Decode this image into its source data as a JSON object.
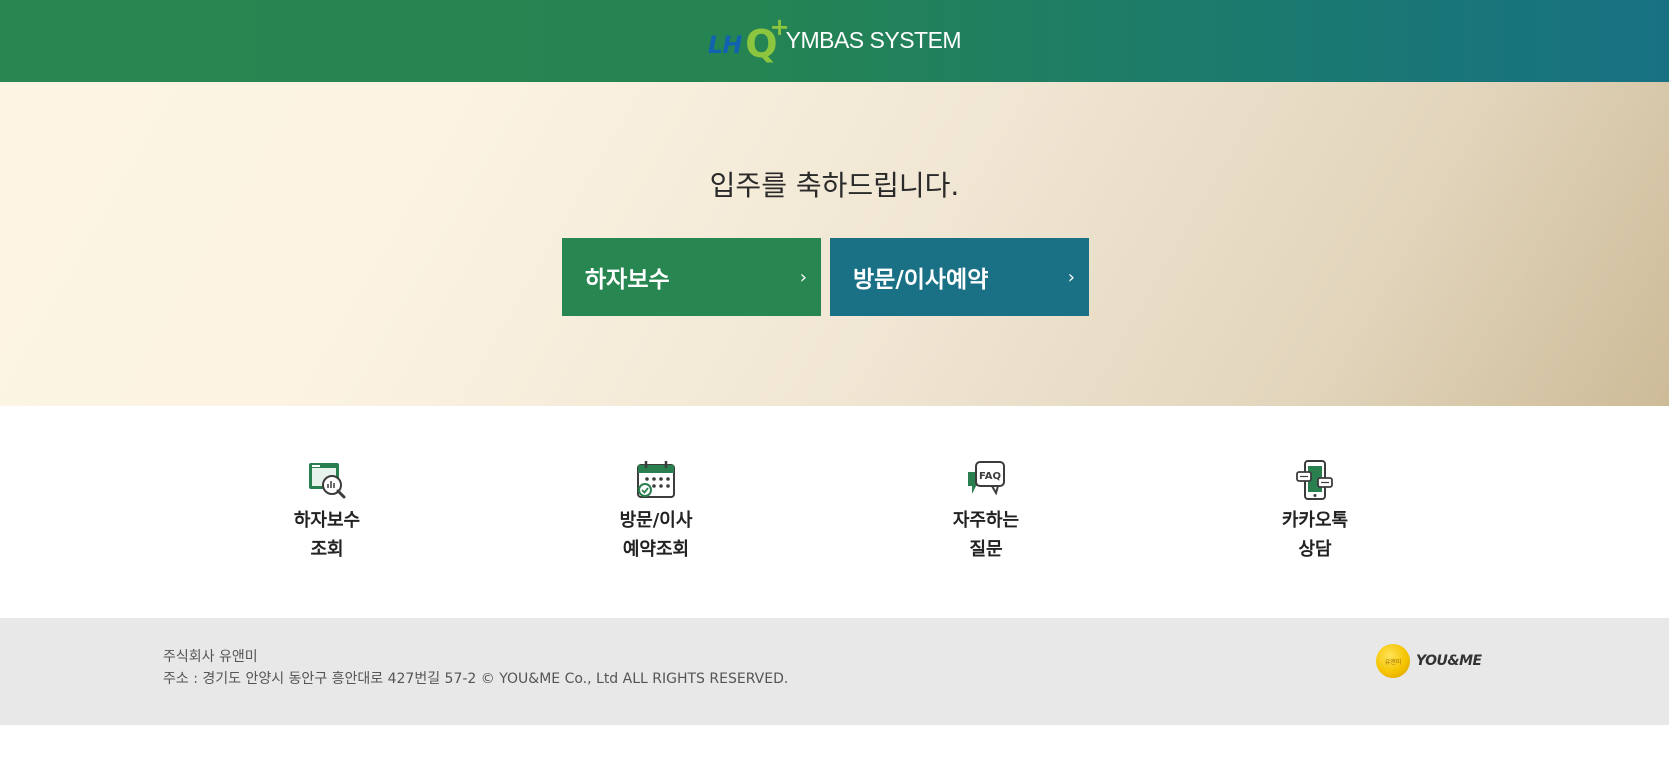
{
  "header": {
    "logo_lh": "LH",
    "logo_q": "Q",
    "logo_plus": "+",
    "logo_system": "YMBAS SYSTEM"
  },
  "hero": {
    "title": "입주를 축하드립니다.",
    "buttons": [
      {
        "label": "하자보수",
        "chevron": "›",
        "color": "#288650"
      },
      {
        "label": "방문/이사예약",
        "chevron": "›",
        "color": "#1a7185"
      }
    ]
  },
  "quick_links": [
    {
      "line1": "하자보수",
      "line2": "조회",
      "icon": "defect-search-icon"
    },
    {
      "line1": "방문/이사",
      "line2": "예약조회",
      "icon": "calendar-icon"
    },
    {
      "line1": "자주하는",
      "line2": "질문",
      "icon": "faq-icon"
    },
    {
      "line1": "카카오톡",
      "line2": "상담",
      "icon": "mobile-chat-icon"
    }
  ],
  "footer": {
    "company": "주식회사 유앤미",
    "address": "주소 : 경기도 안양시 동안구 흥안대로 427번길 57-2 © YOU&ME Co., Ltd ALL RIGHTS RESERVED.",
    "logo_text": "YOU&ME",
    "logo_coin_text": "유앤미"
  },
  "colors": {
    "green": "#288650",
    "teal": "#1a7185",
    "icon_green": "#2a7f4f",
    "icon_dark": "#3c3c3c"
  }
}
